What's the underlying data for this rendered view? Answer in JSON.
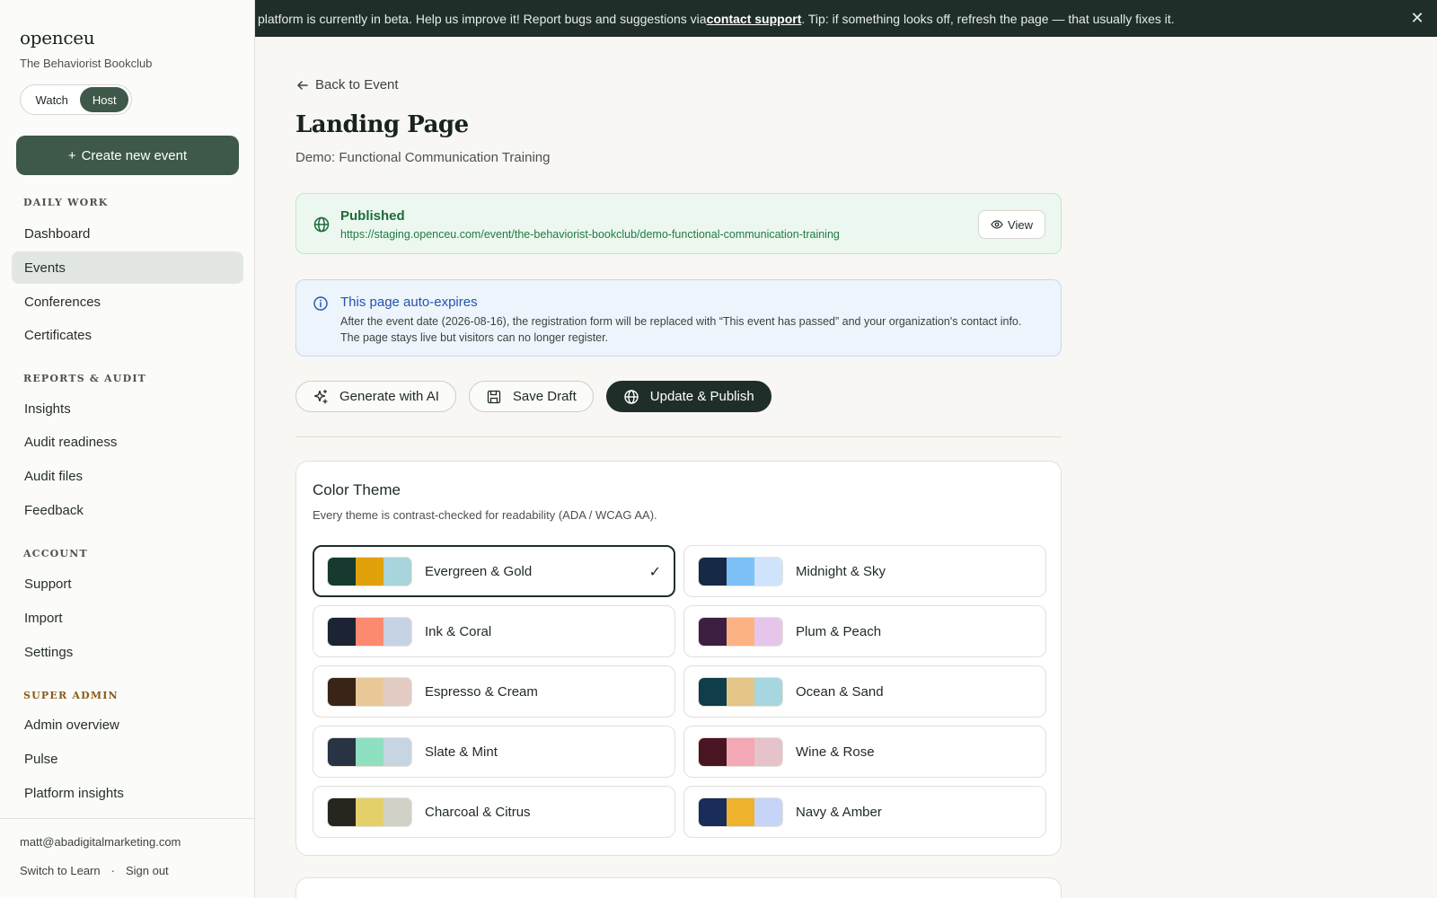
{
  "sidebar": {
    "brand": "openceu",
    "org": "The Behaviorist Bookclub",
    "mode": {
      "watch": "Watch",
      "host": "Host",
      "active": "Host"
    },
    "create_button": "Create new event",
    "sections": [
      {
        "title": "DAILY WORK",
        "items": [
          "Dashboard",
          "Events",
          "Conferences",
          "Certificates"
        ]
      },
      {
        "title": "REPORTS & AUDIT",
        "items": [
          "Insights",
          "Audit readiness",
          "Audit files",
          "Feedback"
        ]
      },
      {
        "title": "ACCOUNT",
        "items": [
          "Support",
          "Import",
          "Settings"
        ]
      },
      {
        "title": "SUPER ADMIN",
        "items": [
          "Admin overview",
          "Pulse",
          "Platform insights"
        ]
      }
    ],
    "active_item": "Events",
    "user_email": "matt@abadigitalmarketing.com",
    "switch_label": "Switch to Learn",
    "separator": "·",
    "signout_label": "Sign out"
  },
  "banner": {
    "text_before": "platform is currently in beta. Help us improve it! Report bugs and suggestions via ",
    "link": "contact support",
    "text_after": ". Tip: if something looks off, refresh the page — that usually fixes it.",
    "close": "✕"
  },
  "main": {
    "back_label": "Back to Event",
    "title": "Landing Page",
    "subtitle": "Demo: Functional Communication Training",
    "status": {
      "title": "Published",
      "url": "https://staging.openceu.com/event/the-behaviorist-bookclub/demo-functional-communication-training",
      "view_label": "View",
      "color": "#1c6b3a"
    },
    "info": {
      "title": "This page auto-expires",
      "body": "After the event date (2026-08-16), the registration form will be replaced with “This event has passed” and your organization's contact info. The page stays live but visitors can no longer register.",
      "color": "#2054b0"
    },
    "actions": {
      "generate": "Generate with AI",
      "save": "Save Draft",
      "publish": "Update & Publish"
    },
    "theme": {
      "title": "Color Theme",
      "subtitle": "Every theme is contrast-checked for readability (ADA / WCAG AA).",
      "selected": "Evergreen & Gold",
      "check": "✓",
      "options": [
        {
          "name": "Evergreen & Gold",
          "colors": [
            "#163a30",
            "#e0a10a",
            "#a8d4dc"
          ]
        },
        {
          "name": "Midnight & Sky",
          "colors": [
            "#162a48",
            "#7cc0f5",
            "#cfe3fb"
          ]
        },
        {
          "name": "Ink & Coral",
          "colors": [
            "#1c2433",
            "#fb8a6e",
            "#c6d3e4"
          ]
        },
        {
          "name": "Plum & Peach",
          "colors": [
            "#3d1f42",
            "#fdb283",
            "#e5c6ea"
          ]
        },
        {
          "name": "Espresso & Cream",
          "colors": [
            "#3a2418",
            "#e9c898",
            "#e1cbc3"
          ]
        },
        {
          "name": "Ocean & Sand",
          "colors": [
            "#0f3d4a",
            "#e3c588",
            "#a6d6e0"
          ]
        },
        {
          "name": "Slate & Mint",
          "colors": [
            "#283444",
            "#8fe0c0",
            "#c7d4e2"
          ]
        },
        {
          "name": "Wine & Rose",
          "colors": [
            "#4a1522",
            "#f3a8b6",
            "#e6c3ca"
          ]
        },
        {
          "name": "Charcoal & Citrus",
          "colors": [
            "#26261e",
            "#e4d06a",
            "#d2d1c6"
          ]
        },
        {
          "name": "Navy & Amber",
          "colors": [
            "#1a2d5a",
            "#efb22c",
            "#c6d5f7"
          ]
        }
      ]
    }
  },
  "icons": {
    "back": "arrow-left-icon",
    "globe": "globe-icon",
    "info": "info-icon",
    "eye": "eye-icon",
    "sparkle": "sparkle-icon",
    "save": "floppy-disk-icon",
    "close": "close-icon"
  }
}
